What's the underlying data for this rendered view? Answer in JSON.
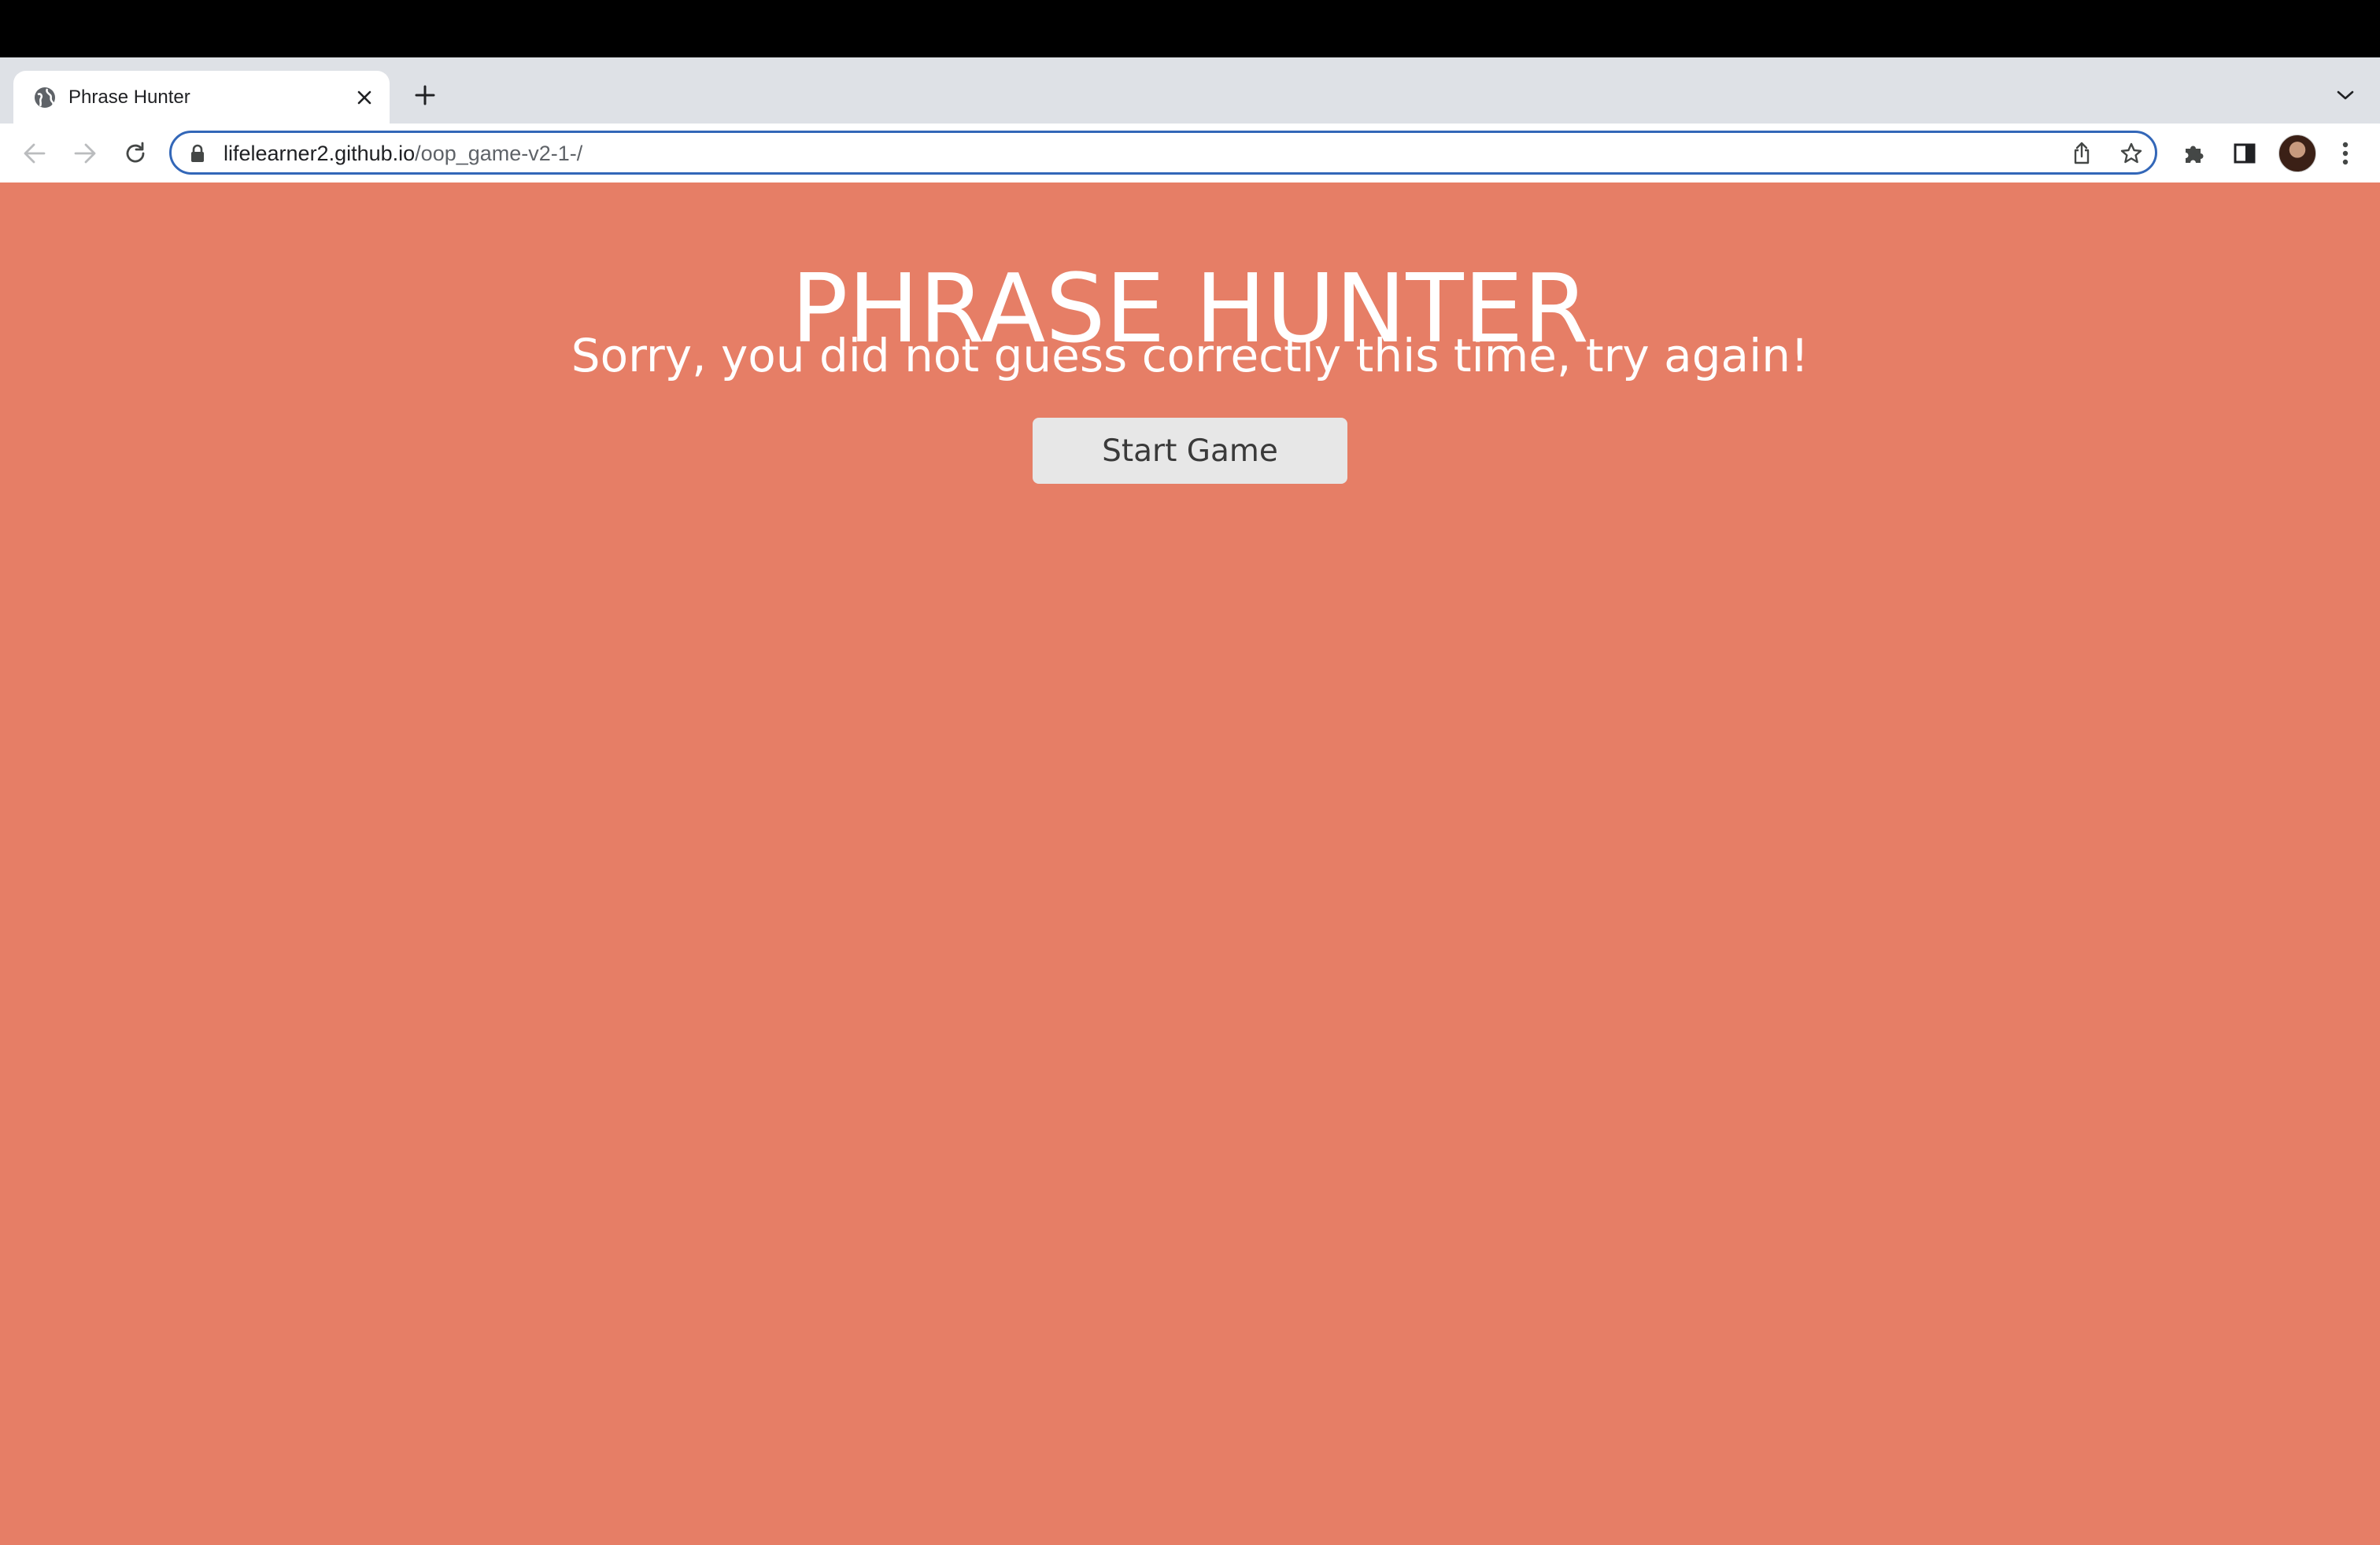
{
  "browser": {
    "tab": {
      "title": "Phrase Hunter",
      "favicon": "globe-icon"
    },
    "new_tab_icon": "plus-icon",
    "tab_search_icon": "chevron-down-icon",
    "address": {
      "host": "lifelearner2.github.io",
      "path": "/oop_game-v2-1-/",
      "lock_icon": "lock-icon"
    },
    "nav_icons": [
      "back-arrow-icon",
      "forward-arrow-icon",
      "reload-icon"
    ],
    "omnibox_icons": [
      "share-icon",
      "star-icon"
    ],
    "toolbar_icons": [
      "extensions-puzzle-icon",
      "side-panel-icon",
      "avatar",
      "kebab-menu-icon"
    ],
    "focus_color": "#3367b8"
  },
  "page": {
    "background": "#e67e66",
    "title": "PHRASE HUNTER",
    "message": "Sorry, you did not guess correctly this time, try again!",
    "start_button": "Start Game"
  }
}
